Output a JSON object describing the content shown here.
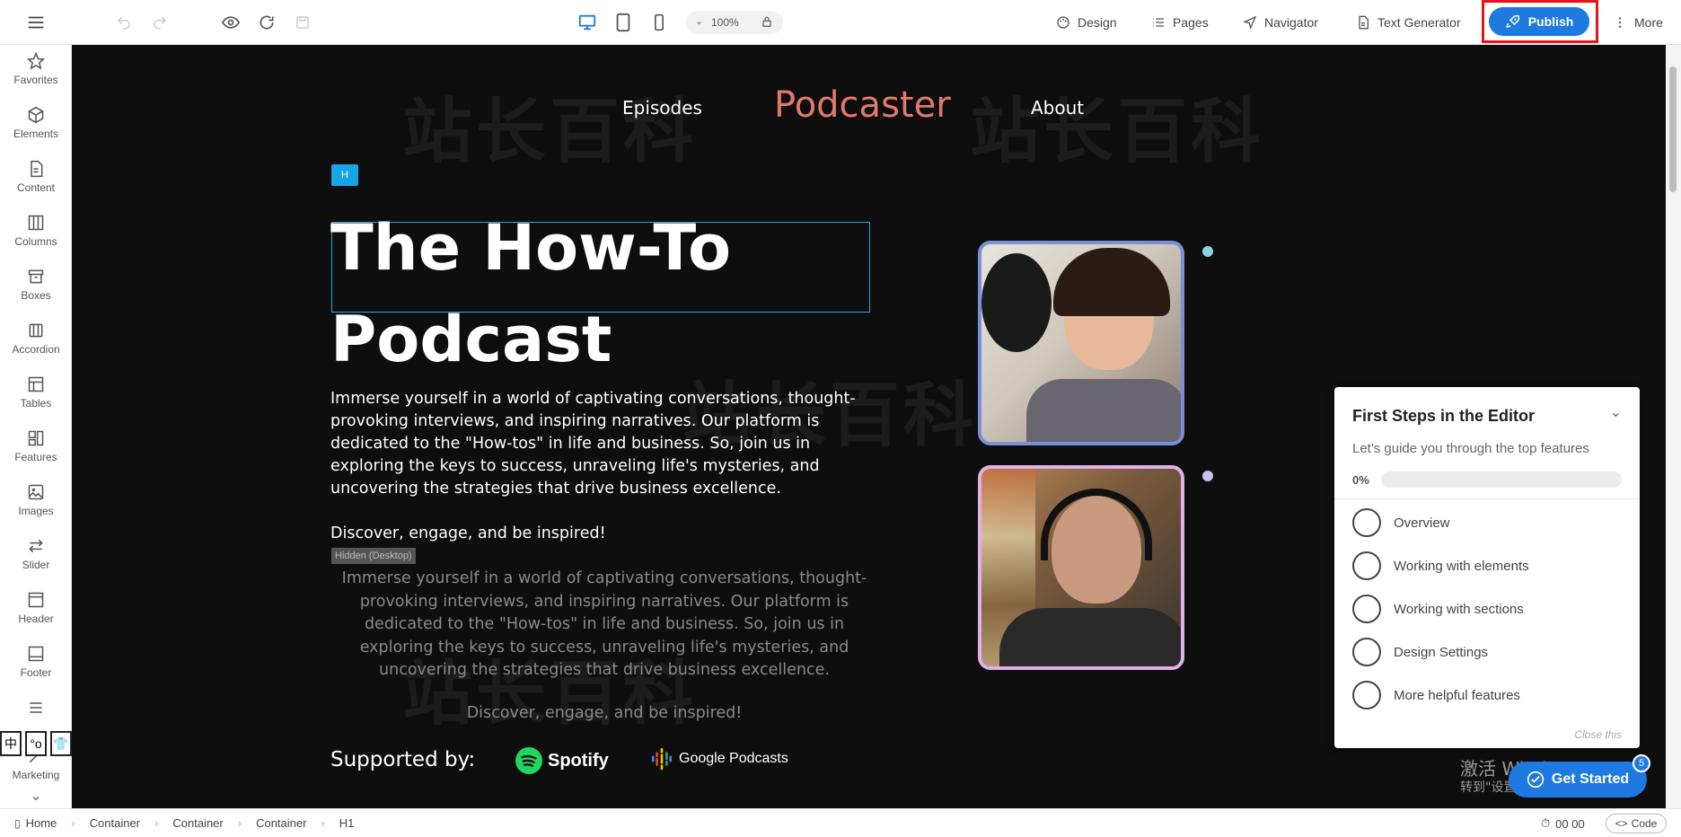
{
  "toolbar": {
    "zoom": "100%",
    "design": "Design",
    "pages": "Pages",
    "navigator": "Navigator",
    "text_generator": "Text Generator",
    "publish": "Publish",
    "more": "More"
  },
  "sidebar": {
    "items": [
      {
        "label": "Favorites",
        "icon": "star-icon"
      },
      {
        "label": "Elements",
        "icon": "cube-icon"
      },
      {
        "label": "Content",
        "icon": "document-icon"
      },
      {
        "label": "Columns",
        "icon": "columns-icon"
      },
      {
        "label": "Boxes",
        "icon": "box-icon"
      },
      {
        "label": "Accordion",
        "icon": "accordion-icon"
      },
      {
        "label": "Tables",
        "icon": "table-icon"
      },
      {
        "label": "Features",
        "icon": "features-icon"
      },
      {
        "label": "Images",
        "icon": "image-icon"
      },
      {
        "label": "Slider",
        "icon": "slider-icon"
      },
      {
        "label": "Header",
        "icon": "header-icon"
      },
      {
        "label": "Footer",
        "icon": "footer-icon"
      },
      {
        "label": "Marketing",
        "icon": "marketing-icon"
      }
    ]
  },
  "site": {
    "nav_episodes": "Episodes",
    "brand": "Podcaster",
    "nav_about": "About",
    "heading_tag": "H",
    "heading": "The How-To Podcast",
    "paragraph": "Immerse yourself in a world of captivating conversations, thought-provoking interviews, and inspiring narratives. Our platform is dedicated to the \"How-tos\" in life and business. So, join us in exploring the keys to success, unraveling life's mysteries, and uncovering the strategies that drive business excellence.",
    "paragraph2": "Discover, engage, and be inspired!",
    "hidden_tag": "Hidden (Desktop)",
    "supported_by": "Supported by:",
    "spotify": "Spotify",
    "google_podcasts": "Google Podcasts"
  },
  "first_steps": {
    "title": "First Steps in the Editor",
    "subtitle": "Let's guide you through the top features",
    "progress_label": "0%",
    "progress": 0,
    "steps": [
      "Overview",
      "Working with elements",
      "Working with sections",
      "Design Settings",
      "More helpful features"
    ],
    "close": "Close this"
  },
  "get_started": {
    "label": "Get Started",
    "badge": "5"
  },
  "windows_watermark": {
    "line1": "激活 Windows",
    "line2": "转到\"设置\"以激活 Windows。"
  },
  "breadcrumb": [
    "Home",
    "Container",
    "Container",
    "Container",
    "H1"
  ],
  "status": {
    "time": "00 00",
    "code": "Code"
  },
  "ime": [
    "中",
    "°o",
    "👕"
  ],
  "colors": {
    "accent": "#1e7ae0",
    "brand": "#e07a6a",
    "canvas": "#0e0e0e",
    "publish_highlight": "#e5131c"
  }
}
